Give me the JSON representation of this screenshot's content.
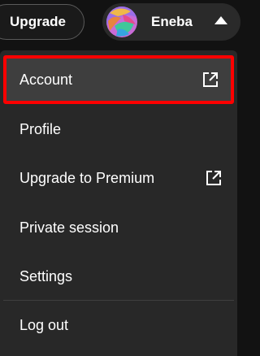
{
  "header": {
    "upgrade_label": "Upgrade",
    "user_name": "Eneba"
  },
  "menu": {
    "items": [
      {
        "label": "Account",
        "external": true,
        "active": true
      },
      {
        "label": "Profile",
        "external": false
      },
      {
        "label": "Upgrade to Premium",
        "external": true
      },
      {
        "label": "Private session",
        "external": false
      },
      {
        "label": "Settings",
        "external": false
      },
      {
        "label": "Log out",
        "external": false
      }
    ]
  },
  "colors": {
    "background": "#121212",
    "menu_background": "#282828",
    "active_item_background": "#3e3e3e",
    "highlight_border": "#ff0000",
    "text": "#ffffff"
  },
  "icons": {
    "avatar": "avatar",
    "caret": "caret-up-icon",
    "external_link": "external-link-icon"
  }
}
